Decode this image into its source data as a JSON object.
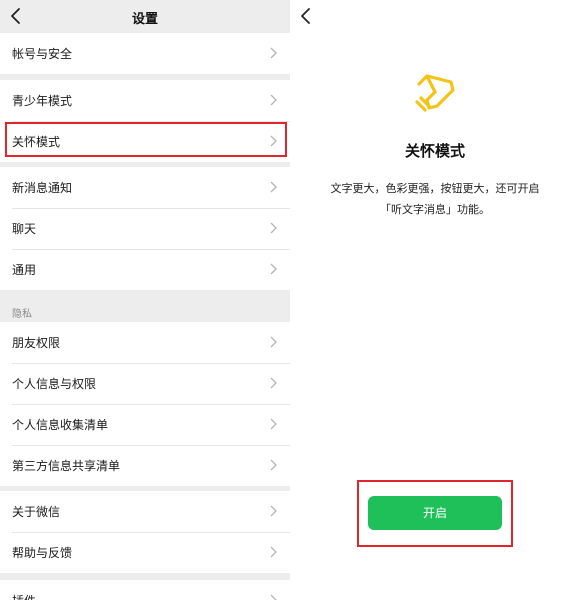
{
  "settings": {
    "title": "设置",
    "groups": [
      [
        "帐号与安全"
      ],
      [
        "青少年模式",
        "关怀模式"
      ],
      [
        "新消息通知",
        "聊天",
        "通用"
      ],
      [
        "朋友权限",
        "个人信息与权限",
        "个人信息收集清单",
        "第三方信息共享清单"
      ],
      [
        "关于微信",
        "帮助与反馈"
      ],
      [
        "插件"
      ]
    ],
    "privacy_section": "隐私"
  },
  "care_mode": {
    "title": "关怀模式",
    "desc_line1": "文字更大，色彩更强，按钮更大，还可开启",
    "desc_line2": "「听文字消息」功能。",
    "enable_label": "开启"
  },
  "colors": {
    "accent_green": "#1fc05a",
    "highlight_red": "#e0262b",
    "care_icon_yellow": "#f2c418"
  },
  "icons": [
    "back-chevron-icon",
    "chevron-right-icon",
    "care-mode-icon"
  ]
}
